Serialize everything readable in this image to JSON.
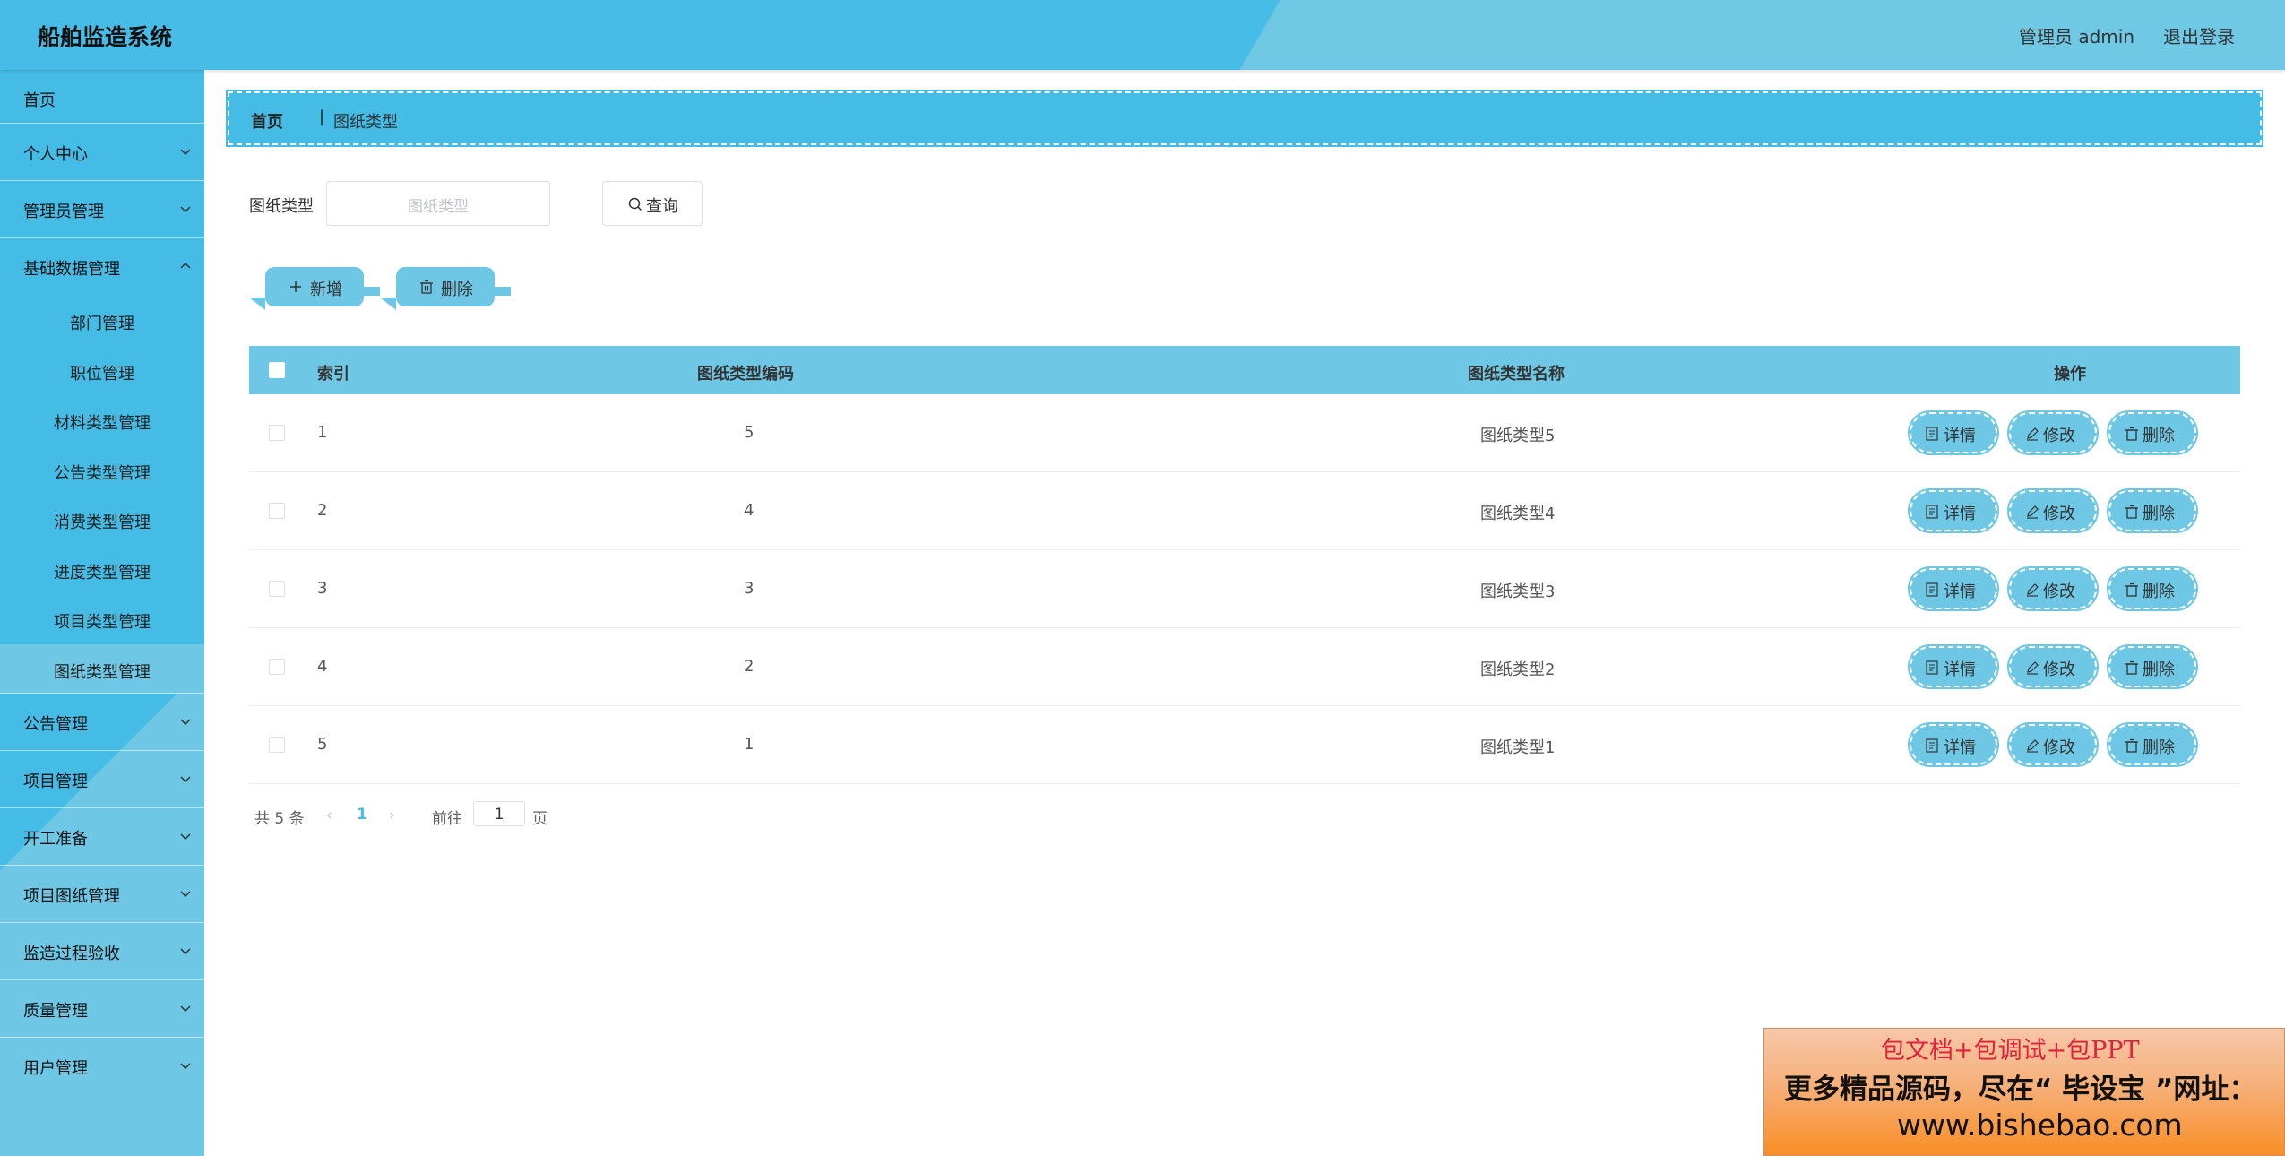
{
  "header": {
    "title": "船舶监造系统",
    "user": "管理员 admin",
    "logout": "退出登录"
  },
  "sidebar": {
    "items": [
      {
        "label": "首页"
      },
      {
        "label": "个人中心"
      },
      {
        "label": "管理员管理"
      },
      {
        "label": "基础数据管理"
      },
      {
        "label": "部门管理"
      },
      {
        "label": "职位管理"
      },
      {
        "label": "材料类型管理"
      },
      {
        "label": "公告类型管理"
      },
      {
        "label": "消费类型管理"
      },
      {
        "label": "进度类型管理"
      },
      {
        "label": "项目类型管理"
      },
      {
        "label": "图纸类型管理"
      },
      {
        "label": "公告管理"
      },
      {
        "label": "项目管理"
      },
      {
        "label": "开工准备"
      },
      {
        "label": "项目图纸管理"
      },
      {
        "label": "监造过程验收"
      },
      {
        "label": "质量管理"
      },
      {
        "label": "用户管理"
      }
    ]
  },
  "breadcrumb": {
    "home": "首页",
    "separator": "|",
    "current": "图纸类型"
  },
  "search": {
    "label": "图纸类型",
    "placeholder": "图纸类型",
    "button": "查询"
  },
  "actions": {
    "add": "新增",
    "delete": "删除"
  },
  "table": {
    "columns": [
      "索引",
      "图纸类型编码",
      "图纸类型名称",
      "操作"
    ],
    "rows": [
      {
        "index": "1",
        "code": "5",
        "name": "图纸类型5"
      },
      {
        "index": "2",
        "code": "4",
        "name": "图纸类型4"
      },
      {
        "index": "3",
        "code": "3",
        "name": "图纸类型3"
      },
      {
        "index": "4",
        "code": "2",
        "name": "图纸类型2"
      },
      {
        "index": "5",
        "code": "1",
        "name": "图纸类型1"
      }
    ],
    "ops": {
      "detail": "详情",
      "edit": "修改",
      "delete": "删除"
    }
  },
  "pagination": {
    "total": "共 5 条",
    "prev": "‹",
    "page": "1",
    "next": "›",
    "goto": "前往",
    "goto_value": "1",
    "suffix": "页"
  },
  "ad": {
    "line1": "包文档+包调试+包PPT",
    "line2": "更多精品源码，尽在“ 毕设宝 ”网址：",
    "line3": "www.bishebao.com"
  },
  "colors": {
    "primary": "#45bce6",
    "secondary": "#6ec7e4"
  }
}
